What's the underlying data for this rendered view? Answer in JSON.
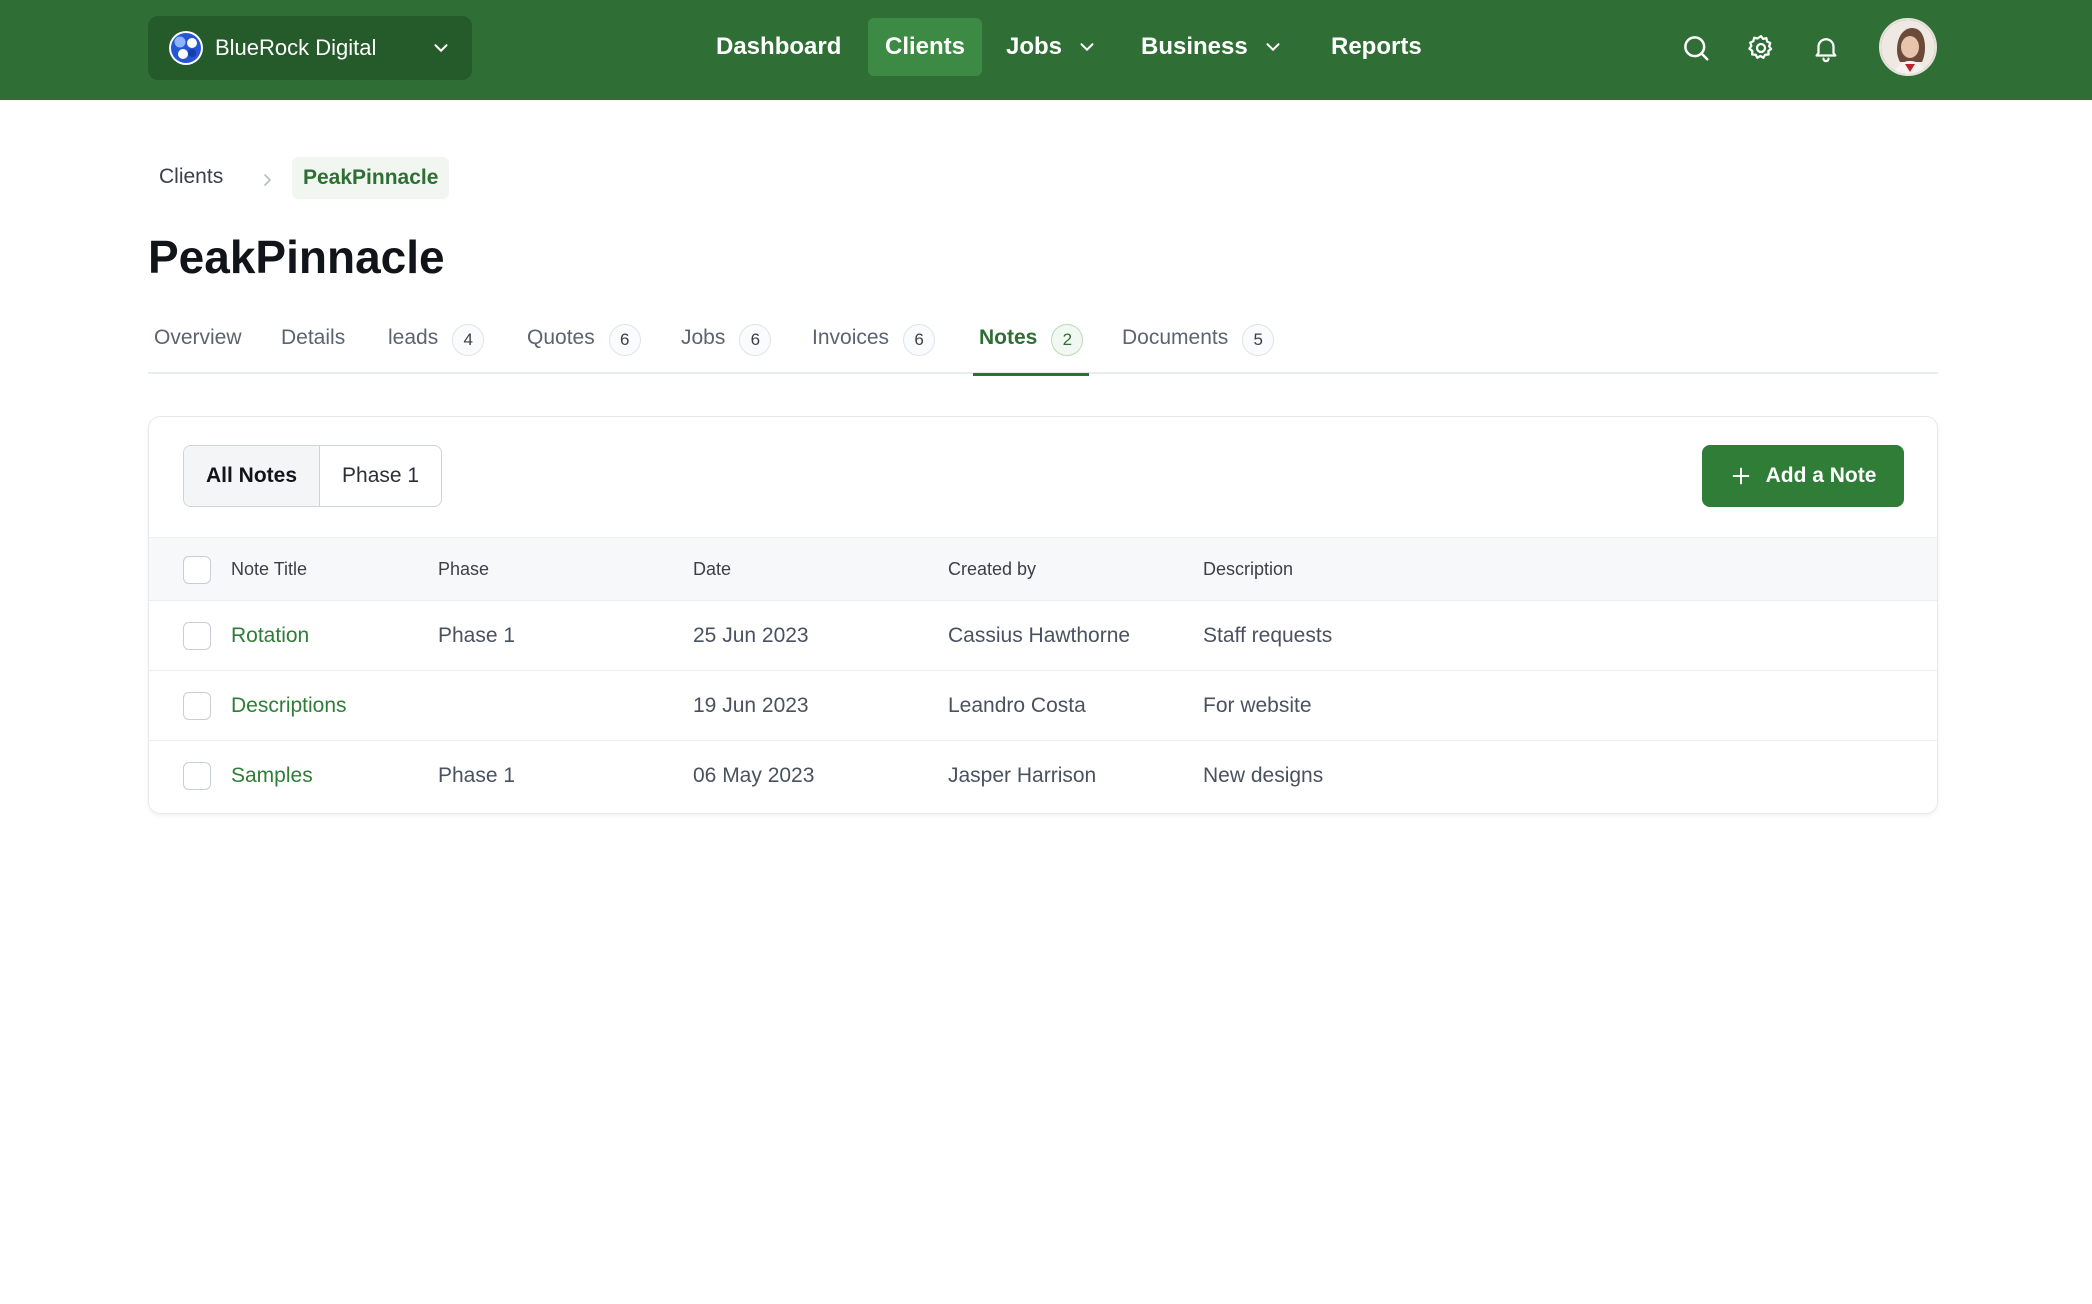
{
  "header": {
    "workspace_name": "BlueRock Digital",
    "nav": [
      {
        "label": "Dashboard",
        "has_dropdown": false,
        "active": false
      },
      {
        "label": "Clients",
        "has_dropdown": false,
        "active": true
      },
      {
        "label": "Jobs",
        "has_dropdown": true,
        "active": false
      },
      {
        "label": "Business",
        "has_dropdown": true,
        "active": false
      },
      {
        "label": "Reports",
        "has_dropdown": false,
        "active": false
      }
    ],
    "icons": [
      "search-icon",
      "gear-icon",
      "bell-icon"
    ]
  },
  "breadcrumb": {
    "root": "Clients",
    "current": "PeakPinnacle"
  },
  "page_title": "PeakPinnacle",
  "tabs": [
    {
      "label": "Overview",
      "count": null,
      "active": false
    },
    {
      "label": "Details",
      "count": null,
      "active": false
    },
    {
      "label": "leads",
      "count": "4",
      "active": false
    },
    {
      "label": "Quotes",
      "count": "6",
      "active": false
    },
    {
      "label": "Jobs",
      "count": "6",
      "active": false
    },
    {
      "label": "Invoices",
      "count": "6",
      "active": false
    },
    {
      "label": "Notes",
      "count": "2",
      "active": true
    },
    {
      "label": "Documents",
      "count": "5",
      "active": false
    }
  ],
  "notes": {
    "filters": [
      {
        "label": "All Notes",
        "active": true
      },
      {
        "label": "Phase 1",
        "active": false
      }
    ],
    "add_button": "Add a Note",
    "columns": [
      "Note Title",
      "Phase",
      "Date",
      "Created by",
      "Description"
    ],
    "rows": [
      {
        "title": "Rotation",
        "phase": "Phase 1",
        "date": "25 Jun 2023",
        "created_by": "Cassius Hawthorne",
        "description": "Staff requests"
      },
      {
        "title": "Descriptions",
        "phase": "",
        "date": "19 Jun 2023",
        "created_by": "Leandro Costa",
        "description": "For website"
      },
      {
        "title": "Samples",
        "phase": "Phase 1",
        "date": "06 May 2023",
        "created_by": "Jasper Harrison",
        "description": "New designs"
      }
    ]
  },
  "colors": {
    "brand_green": "#2f6e34",
    "active_nav": "#3d8a45",
    "link_green": "#2f7d36"
  }
}
